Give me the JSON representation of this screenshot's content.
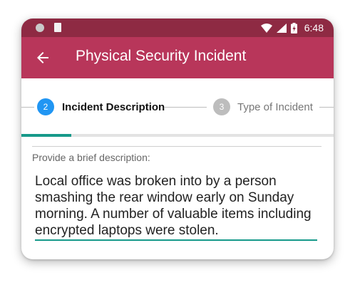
{
  "statusbar": {
    "time": "6:48"
  },
  "appbar": {
    "title": "Physical Security Incident"
  },
  "stepper": {
    "steps": [
      {
        "number": "2",
        "label": "Incident Description",
        "state": "active"
      },
      {
        "number": "3",
        "label": "Type of Incident",
        "state": "inactive"
      }
    ],
    "progress_fraction": 0.16
  },
  "form": {
    "label": "Provide a brief description:",
    "value": "Local office was broken into by a person smashing the rear window early on Sunday morning. A number of valuable items including encrypted laptops were stolen."
  },
  "colors": {
    "status_bar": "#8e2a43",
    "app_bar": "#b8365a",
    "active_step": "#2196f3",
    "inactive_step": "#bdbdbd",
    "accent": "#16998a"
  },
  "icons": [
    "settings-dot-icon",
    "sd-card-icon",
    "wifi-icon",
    "signal-icon",
    "battery-icon",
    "back-arrow-icon"
  ]
}
